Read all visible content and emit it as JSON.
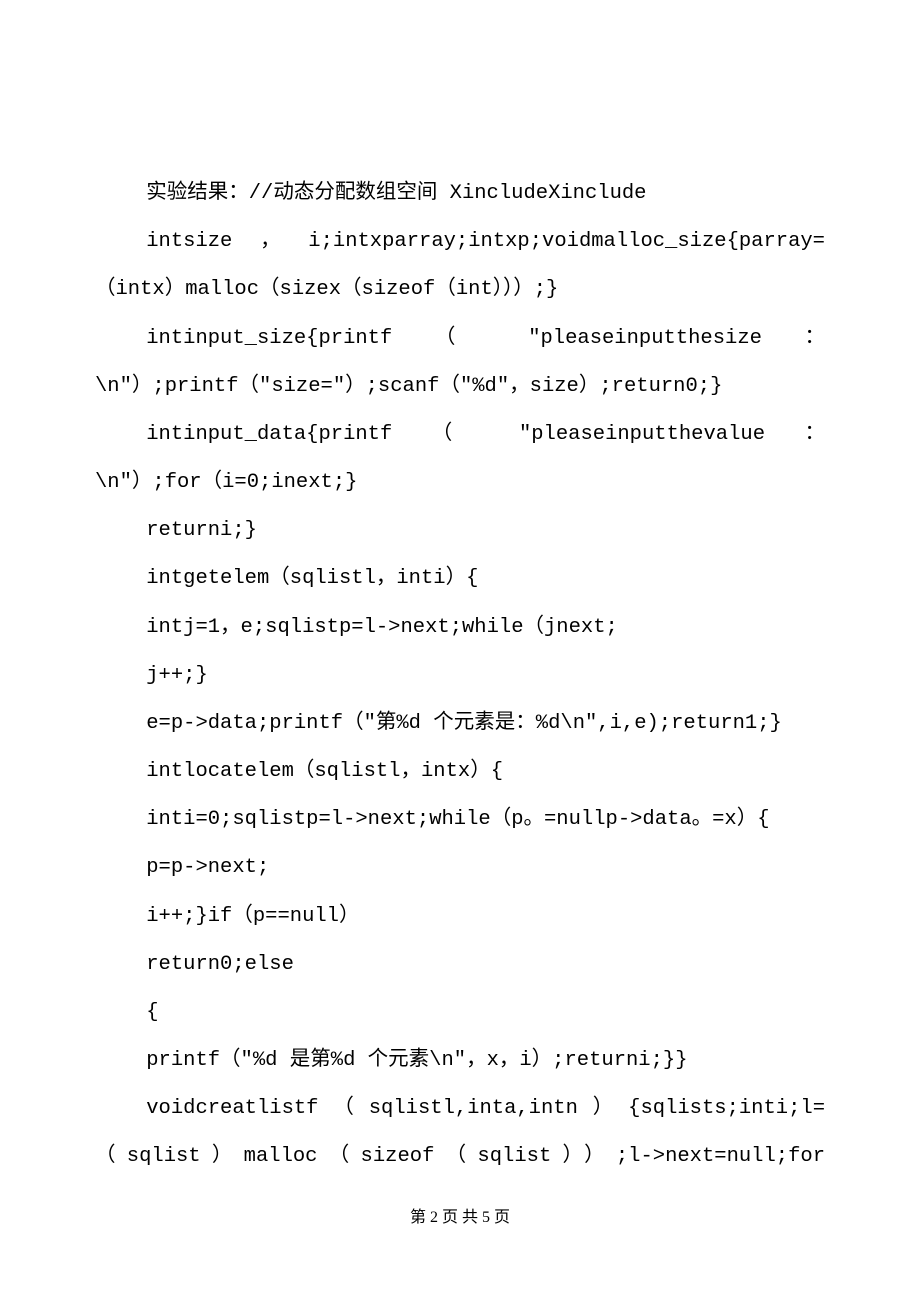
{
  "lines": [
    {
      "text": "实验结果：//动态分配数组空间 XincludeXinclude",
      "indent": true,
      "justify": false
    },
    {
      "text": "intsize，i;intxparray;intxp;voidmalloc_size{parray=",
      "indent": true,
      "justify": true
    },
    {
      "text": "（intx）malloc（sizex（sizeof（int）））;}",
      "indent": false,
      "justify": false
    },
    {
      "text": "intinput_size{printf （ \"pleaseinputthesize ：",
      "indent": true,
      "justify": true
    },
    {
      "text": "\\n\"）;printf（\"size=\"）;scanf（\"%d\"，size）;return0;}",
      "indent": false,
      "justify": false
    },
    {
      "text": "intinput_data{printf （ \"pleaseinputthevalue ：",
      "indent": true,
      "justify": true
    },
    {
      "text": "\\n\"）;for（i=0;inext;}",
      "indent": false,
      "justify": false
    },
    {
      "text": "returni;}",
      "indent": true,
      "justify": false
    },
    {
      "text": "intgetelem（sqlistl，inti）{",
      "indent": true,
      "justify": false
    },
    {
      "text": "intj=1，e;sqlistp=l->next;while（jnext;",
      "indent": true,
      "justify": false
    },
    {
      "text": "j++;}",
      "indent": true,
      "justify": false
    },
    {
      "text": "e=p->data;printf（\"第%d 个元素是：%d\\n\",i,e);return1;}",
      "indent": true,
      "justify": false
    },
    {
      "text": "intlocatelem（sqlistl，intx）{",
      "indent": true,
      "justify": false
    },
    {
      "text": "inti=0;sqlistp=l->next;while（p。=nullp->data。=x）{",
      "indent": true,
      "justify": false
    },
    {
      "text": "p=p->next;",
      "indent": true,
      "justify": false
    },
    {
      "text": "i++;}if（p==null）",
      "indent": true,
      "justify": false
    },
    {
      "text": "return0;else",
      "indent": true,
      "justify": false
    },
    {
      "text": "{",
      "indent": true,
      "justify": false
    },
    {
      "text": "printf（\"%d 是第%d 个元素\\n\"，x，i）;returni;}}",
      "indent": true,
      "justify": false
    },
    {
      "text": "voidcreatlistf（sqlistl,inta,intn）{sqlists;inti;l=",
      "indent": true,
      "justify": true
    },
    {
      "text": "（sqlist）malloc（sizeof（sqlist））;l->next=null;for",
      "indent": false,
      "justify": true
    }
  ],
  "footer": "第 2 页 共 5 页"
}
